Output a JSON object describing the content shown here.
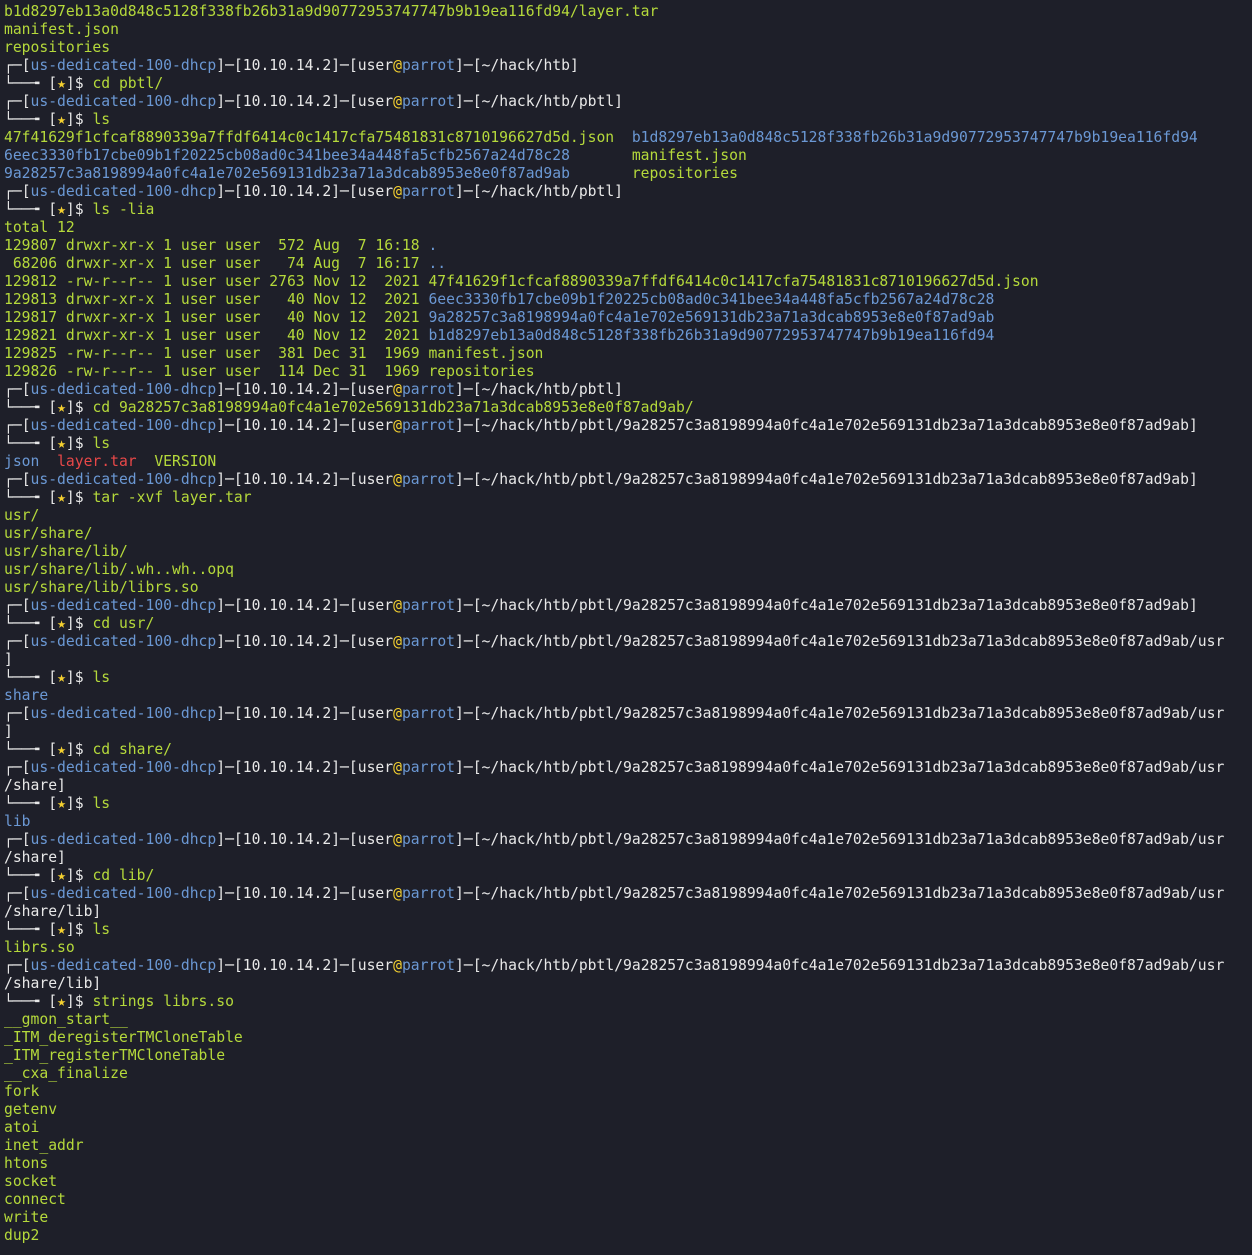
{
  "prompt": {
    "host": "us-dedicated-100-dhcp",
    "ip": "10.10.14.2",
    "user": "user",
    "at": "@",
    "machine": "parrot",
    "prefix": "┌─",
    "sep": "─",
    "lbr": "[",
    "rbr": "]",
    "tail": "└──╼ [",
    "star": "★",
    "suffix": "]$ "
  },
  "lines": [
    {
      "t": "out",
      "s": [
        {
          "c": "g",
          "x": "b1d8297eb13a0d848c5128f338fb26b31a9d90772953747747b9b19ea116fd94/layer.tar"
        }
      ]
    },
    {
      "t": "out",
      "s": [
        {
          "c": "g",
          "x": "manifest.json"
        }
      ]
    },
    {
      "t": "out",
      "s": [
        {
          "c": "g",
          "x": "repositories"
        }
      ]
    },
    {
      "t": "hdr",
      "path": "~/hack/htb",
      "end": "]"
    },
    {
      "t": "cmd",
      "x": "cd pbtl/"
    },
    {
      "t": "hdr",
      "path": "~/hack/htb/pbtl",
      "end": "]"
    },
    {
      "t": "cmd",
      "x": "ls"
    },
    {
      "t": "out",
      "s": [
        {
          "c": "g",
          "x": "47f41629f1cfcaf8890339a7ffdf6414c0c1417cfa75481831c8710196627d5d.json  "
        },
        {
          "c": "b",
          "x": "b1d8297eb13a0d848c5128f338fb26b31a9d90772953747747b9b19ea116fd94"
        }
      ]
    },
    {
      "t": "out",
      "s": [
        {
          "c": "b",
          "x": "6eec3330fb17cbe09b1f20225cb08ad0c341bee34a448fa5cfb2567a24d78c28       "
        },
        {
          "c": "g",
          "x": "manifest.json"
        }
      ]
    },
    {
      "t": "out",
      "s": [
        {
          "c": "b",
          "x": "9a28257c3a8198994a0fc4a1e702e569131db23a71a3dcab8953e8e0f87ad9ab       "
        },
        {
          "c": "g",
          "x": "repositories"
        }
      ]
    },
    {
      "t": "hdr",
      "path": "~/hack/htb/pbtl",
      "end": "]"
    },
    {
      "t": "cmd",
      "x": "ls -lia"
    },
    {
      "t": "out",
      "s": [
        {
          "c": "g",
          "x": "total 12"
        }
      ]
    },
    {
      "t": "out",
      "s": [
        {
          "c": "g",
          "x": "129807 drwxr-xr-x 1 user user  572 Aug  7 16:18 "
        },
        {
          "c": "b",
          "x": "."
        }
      ]
    },
    {
      "t": "out",
      "s": [
        {
          "c": "g",
          "x": " 68206 drwxr-xr-x 1 user user   74 Aug  7 16:17 "
        },
        {
          "c": "b",
          "x": ".."
        }
      ]
    },
    {
      "t": "out",
      "s": [
        {
          "c": "g",
          "x": "129812 -rw-r--r-- 1 user user 2763 Nov 12  2021 47f41629f1cfcaf8890339a7ffdf6414c0c1417cfa75481831c8710196627d5d.json"
        }
      ]
    },
    {
      "t": "out",
      "s": [
        {
          "c": "g",
          "x": "129813 drwxr-xr-x 1 user user   40 Nov 12  2021 "
        },
        {
          "c": "b",
          "x": "6eec3330fb17cbe09b1f20225cb08ad0c341bee34a448fa5cfb2567a24d78c28"
        }
      ]
    },
    {
      "t": "out",
      "s": [
        {
          "c": "g",
          "x": "129817 drwxr-xr-x 1 user user   40 Nov 12  2021 "
        },
        {
          "c": "b",
          "x": "9a28257c3a8198994a0fc4a1e702e569131db23a71a3dcab8953e8e0f87ad9ab"
        }
      ]
    },
    {
      "t": "out",
      "s": [
        {
          "c": "g",
          "x": "129821 drwxr-xr-x 1 user user   40 Nov 12  2021 "
        },
        {
          "c": "b",
          "x": "b1d8297eb13a0d848c5128f338fb26b31a9d90772953747747b9b19ea116fd94"
        }
      ]
    },
    {
      "t": "out",
      "s": [
        {
          "c": "g",
          "x": "129825 -rw-r--r-- 1 user user  381 Dec 31  1969 manifest.json"
        }
      ]
    },
    {
      "t": "out",
      "s": [
        {
          "c": "g",
          "x": "129826 -rw-r--r-- 1 user user  114 Dec 31  1969 repositories"
        }
      ]
    },
    {
      "t": "hdr",
      "path": "~/hack/htb/pbtl",
      "end": "]"
    },
    {
      "t": "cmd",
      "x": "cd 9a28257c3a8198994a0fc4a1e702e569131db23a71a3dcab8953e8e0f87ad9ab/"
    },
    {
      "t": "hdr",
      "path": "~/hack/htb/pbtl/9a28257c3a8198994a0fc4a1e702e569131db23a71a3dcab8953e8e0f87ad9ab",
      "end": "]"
    },
    {
      "t": "cmd",
      "x": "ls"
    },
    {
      "t": "out",
      "s": [
        {
          "c": "b",
          "x": "json"
        },
        {
          "c": "g",
          "x": "  "
        },
        {
          "c": "r",
          "x": "layer.tar"
        },
        {
          "c": "g",
          "x": "  VERSION"
        }
      ]
    },
    {
      "t": "hdr",
      "path": "~/hack/htb/pbtl/9a28257c3a8198994a0fc4a1e702e569131db23a71a3dcab8953e8e0f87ad9ab",
      "end": "]"
    },
    {
      "t": "cmd",
      "x": "tar -xvf layer.tar"
    },
    {
      "t": "out",
      "s": [
        {
          "c": "g",
          "x": "usr/"
        }
      ]
    },
    {
      "t": "out",
      "s": [
        {
          "c": "g",
          "x": "usr/share/"
        }
      ]
    },
    {
      "t": "out",
      "s": [
        {
          "c": "g",
          "x": "usr/share/lib/"
        }
      ]
    },
    {
      "t": "out",
      "s": [
        {
          "c": "g",
          "x": "usr/share/lib/.wh..wh..opq"
        }
      ]
    },
    {
      "t": "out",
      "s": [
        {
          "c": "g",
          "x": "usr/share/lib/librs.so"
        }
      ]
    },
    {
      "t": "hdr",
      "path": "~/hack/htb/pbtl/9a28257c3a8198994a0fc4a1e702e569131db23a71a3dcab8953e8e0f87ad9ab",
      "end": "]"
    },
    {
      "t": "cmd",
      "x": "cd usr/"
    },
    {
      "t": "hdr",
      "path": "~/hack/htb/pbtl/9a28257c3a8198994a0fc4a1e702e569131db23a71a3dcab8953e8e0f87ad9ab/usr",
      "end": ""
    },
    {
      "t": "wrap",
      "x": "]"
    },
    {
      "t": "cmd",
      "x": "ls"
    },
    {
      "t": "out",
      "s": [
        {
          "c": "b",
          "x": "share"
        }
      ]
    },
    {
      "t": "hdr",
      "path": "~/hack/htb/pbtl/9a28257c3a8198994a0fc4a1e702e569131db23a71a3dcab8953e8e0f87ad9ab/usr",
      "end": ""
    },
    {
      "t": "wrap",
      "x": "]"
    },
    {
      "t": "cmd",
      "x": "cd share/"
    },
    {
      "t": "hdr",
      "path": "~/hack/htb/pbtl/9a28257c3a8198994a0fc4a1e702e569131db23a71a3dcab8953e8e0f87ad9ab/usr",
      "end": ""
    },
    {
      "t": "wrap",
      "x": "/share]"
    },
    {
      "t": "cmd",
      "x": "ls"
    },
    {
      "t": "out",
      "s": [
        {
          "c": "b",
          "x": "lib"
        }
      ]
    },
    {
      "t": "hdr",
      "path": "~/hack/htb/pbtl/9a28257c3a8198994a0fc4a1e702e569131db23a71a3dcab8953e8e0f87ad9ab/usr",
      "end": ""
    },
    {
      "t": "wrap",
      "x": "/share]"
    },
    {
      "t": "cmd",
      "x": "cd lib/"
    },
    {
      "t": "hdr",
      "path": "~/hack/htb/pbtl/9a28257c3a8198994a0fc4a1e702e569131db23a71a3dcab8953e8e0f87ad9ab/usr",
      "end": ""
    },
    {
      "t": "wrap",
      "x": "/share/lib]"
    },
    {
      "t": "cmd",
      "x": "ls"
    },
    {
      "t": "out",
      "s": [
        {
          "c": "g",
          "x": "librs.so"
        }
      ]
    },
    {
      "t": "hdr",
      "path": "~/hack/htb/pbtl/9a28257c3a8198994a0fc4a1e702e569131db23a71a3dcab8953e8e0f87ad9ab/usr",
      "end": ""
    },
    {
      "t": "wrap",
      "x": "/share/lib]"
    },
    {
      "t": "cmd",
      "x": "strings librs.so"
    },
    {
      "t": "out",
      "s": [
        {
          "c": "g",
          "x": "__gmon_start__"
        }
      ]
    },
    {
      "t": "out",
      "s": [
        {
          "c": "g",
          "x": "_ITM_deregisterTMCloneTable"
        }
      ]
    },
    {
      "t": "out",
      "s": [
        {
          "c": "g",
          "x": "_ITM_registerTMCloneTable"
        }
      ]
    },
    {
      "t": "out",
      "s": [
        {
          "c": "g",
          "x": "__cxa_finalize"
        }
      ]
    },
    {
      "t": "out",
      "s": [
        {
          "c": "g",
          "x": "fork"
        }
      ]
    },
    {
      "t": "out",
      "s": [
        {
          "c": "g",
          "x": "getenv"
        }
      ]
    },
    {
      "t": "out",
      "s": [
        {
          "c": "g",
          "x": "atoi"
        }
      ]
    },
    {
      "t": "out",
      "s": [
        {
          "c": "g",
          "x": "inet_addr"
        }
      ]
    },
    {
      "t": "out",
      "s": [
        {
          "c": "g",
          "x": "htons"
        }
      ]
    },
    {
      "t": "out",
      "s": [
        {
          "c": "g",
          "x": "socket"
        }
      ]
    },
    {
      "t": "out",
      "s": [
        {
          "c": "g",
          "x": "connect"
        }
      ]
    },
    {
      "t": "out",
      "s": [
        {
          "c": "g",
          "x": "write"
        }
      ]
    },
    {
      "t": "out",
      "s": [
        {
          "c": "g",
          "x": "dup2"
        }
      ]
    }
  ]
}
